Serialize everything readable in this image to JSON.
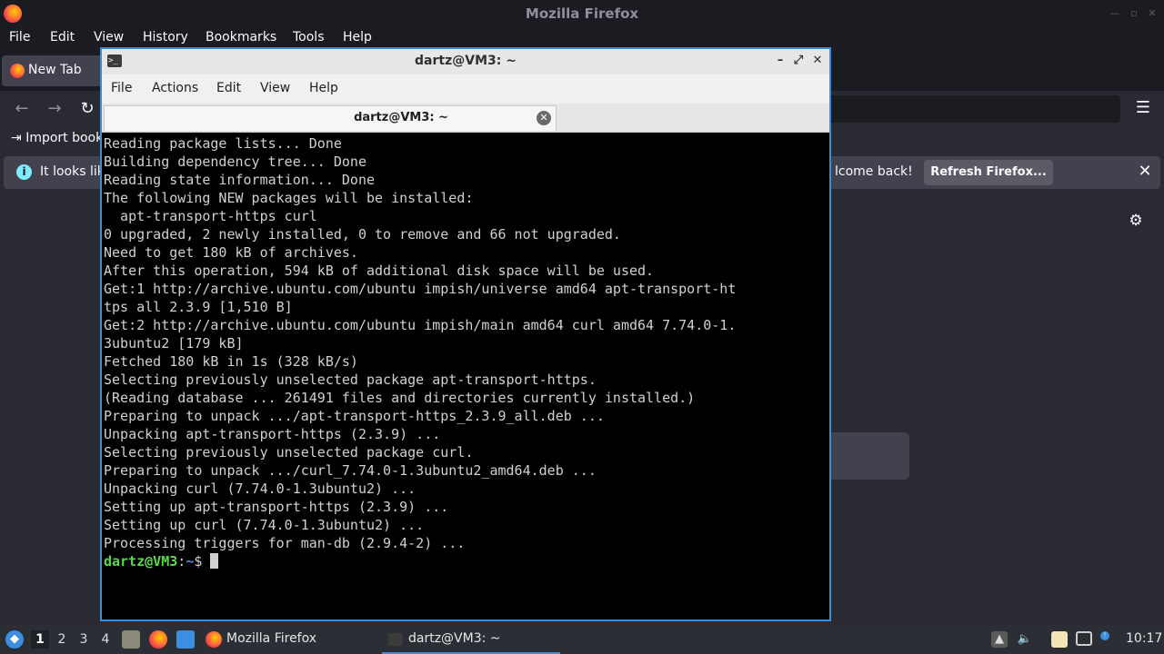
{
  "firefox": {
    "window_title": "Mozilla Firefox",
    "menus": [
      "File",
      "Edit",
      "View",
      "History",
      "Bookmarks",
      "Tools",
      "Help"
    ],
    "tab_label": "New Tab",
    "import_label": "Import bookmarks...",
    "import_visible": "Import book",
    "notice_text": "It looks lik",
    "notice_text_right": "lcome back!",
    "refresh_label": "Refresh Firefox..."
  },
  "terminal": {
    "window_title": "dartz@VM3: ~",
    "menus": [
      "File",
      "Actions",
      "Edit",
      "View",
      "Help"
    ],
    "tab_label": "dartz@VM3: ~",
    "lines": [
      "Reading package lists... Done",
      "Building dependency tree... Done",
      "Reading state information... Done",
      "The following NEW packages will be installed:",
      "  apt-transport-https curl",
      "0 upgraded, 2 newly installed, 0 to remove and 66 not upgraded.",
      "Need to get 180 kB of archives.",
      "After this operation, 594 kB of additional disk space will be used.",
      "Get:1 http://archive.ubuntu.com/ubuntu impish/universe amd64 apt-transport-ht",
      "tps all 2.3.9 [1,510 B]",
      "Get:2 http://archive.ubuntu.com/ubuntu impish/main amd64 curl amd64 7.74.0-1.",
      "3ubuntu2 [179 kB]",
      "Fetched 180 kB in 1s (328 kB/s)",
      "Selecting previously unselected package apt-transport-https.",
      "(Reading database ... 261491 files and directories currently installed.)",
      "Preparing to unpack .../apt-transport-https_2.3.9_all.deb ...",
      "Unpacking apt-transport-https (2.3.9) ...",
      "Selecting previously unselected package curl.",
      "Preparing to unpack .../curl_7.74.0-1.3ubuntu2_amd64.deb ...",
      "Unpacking curl (7.74.0-1.3ubuntu2) ...",
      "Setting up apt-transport-https (2.3.9) ...",
      "Setting up curl (7.74.0-1.3ubuntu2) ...",
      "Processing triggers for man-db (2.9.4-2) ..."
    ],
    "prompt_user": "dartz@VM3",
    "prompt_sep": ":",
    "prompt_path": "~",
    "prompt_symbol": "$ "
  },
  "taskbar": {
    "workspaces": [
      "1",
      "2",
      "3",
      "4"
    ],
    "active_workspace": "1",
    "tasks": [
      {
        "label": "Mozilla Firefox",
        "icon": "firefox-icon"
      },
      {
        "label": "dartz@VM3: ~",
        "icon": "terminal-icon"
      }
    ],
    "clock": "10:17"
  },
  "colors": {
    "accent": "#3e8bd8",
    "prompt_user": "#5ad94a",
    "prompt_path": "#4a8fe6",
    "terminal_bg": "#000000"
  }
}
